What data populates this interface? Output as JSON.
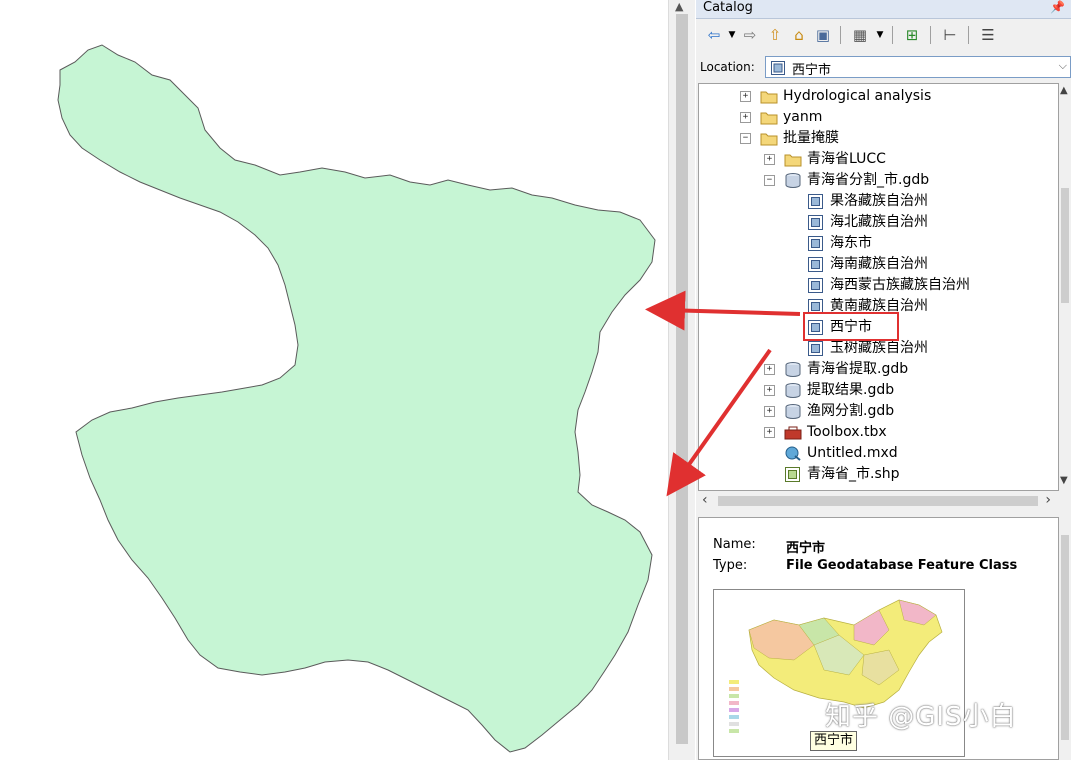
{
  "catalog": {
    "title": "Catalog",
    "pin_icon": "pin-icon",
    "toolbar_icons": [
      "back-icon",
      "dropdown-icon",
      "forward-icon",
      "up-folder-icon",
      "home-icon",
      "toggle-tree-icon",
      "view-options-icon",
      "dropdown-icon",
      "connect-folder-icon",
      "hierarchy-icon",
      "details-icon"
    ],
    "location_label": "Location:",
    "location_value": "西宁市"
  },
  "tree": {
    "items": [
      {
        "label": "Hydrological analysis",
        "icon": "folder-icon",
        "expander": "+"
      },
      {
        "label": "yanm",
        "icon": "folder-icon",
        "expander": "+"
      },
      {
        "label": "批量掩膜",
        "icon": "folder-icon",
        "expander": "−"
      },
      {
        "label": "青海省LUCC",
        "icon": "folder-icon",
        "expander": "+"
      },
      {
        "label": "青海省分割_市.gdb",
        "icon": "geodatabase-icon",
        "expander": "−"
      },
      {
        "label": "果洛藏族自治州",
        "icon": "feature-class-icon",
        "expander": ""
      },
      {
        "label": "海北藏族自治州",
        "icon": "feature-class-icon",
        "expander": ""
      },
      {
        "label": "海东市",
        "icon": "feature-class-icon",
        "expander": ""
      },
      {
        "label": "海南藏族自治州",
        "icon": "feature-class-icon",
        "expander": ""
      },
      {
        "label": "海西蒙古族藏族自治州",
        "icon": "feature-class-icon",
        "expander": ""
      },
      {
        "label": "黄南藏族自治州",
        "icon": "feature-class-icon",
        "expander": ""
      },
      {
        "label": "西宁市",
        "icon": "feature-class-icon",
        "expander": "",
        "selected": true
      },
      {
        "label": "玉树藏族自治州",
        "icon": "feature-class-icon",
        "expander": ""
      },
      {
        "label": "青海省提取.gdb",
        "icon": "geodatabase-icon",
        "expander": "+"
      },
      {
        "label": "提取结果.gdb",
        "icon": "geodatabase-icon",
        "expander": "+"
      },
      {
        "label": "渔网分割.gdb",
        "icon": "geodatabase-icon",
        "expander": "+"
      },
      {
        "label": "Toolbox.tbx",
        "icon": "toolbox-icon",
        "expander": "+"
      },
      {
        "label": "Untitled.mxd",
        "icon": "map-document-icon",
        "expander": ""
      },
      {
        "label": "青海省_市.shp",
        "icon": "shapefile-icon",
        "expander": ""
      }
    ]
  },
  "preview": {
    "name_label": "Name:",
    "name_value": "西宁市",
    "type_label": "Type:",
    "type_value": "File Geodatabase Feature Class",
    "tooltip": "西宁市",
    "watermark": "知乎 @GIS小白"
  },
  "colors": {
    "polygon_fill": "#c6f5d4",
    "polygon_stroke": "#5a5a5a",
    "annotation_red": "#e03030",
    "title_bar": "#dfe7f3"
  }
}
